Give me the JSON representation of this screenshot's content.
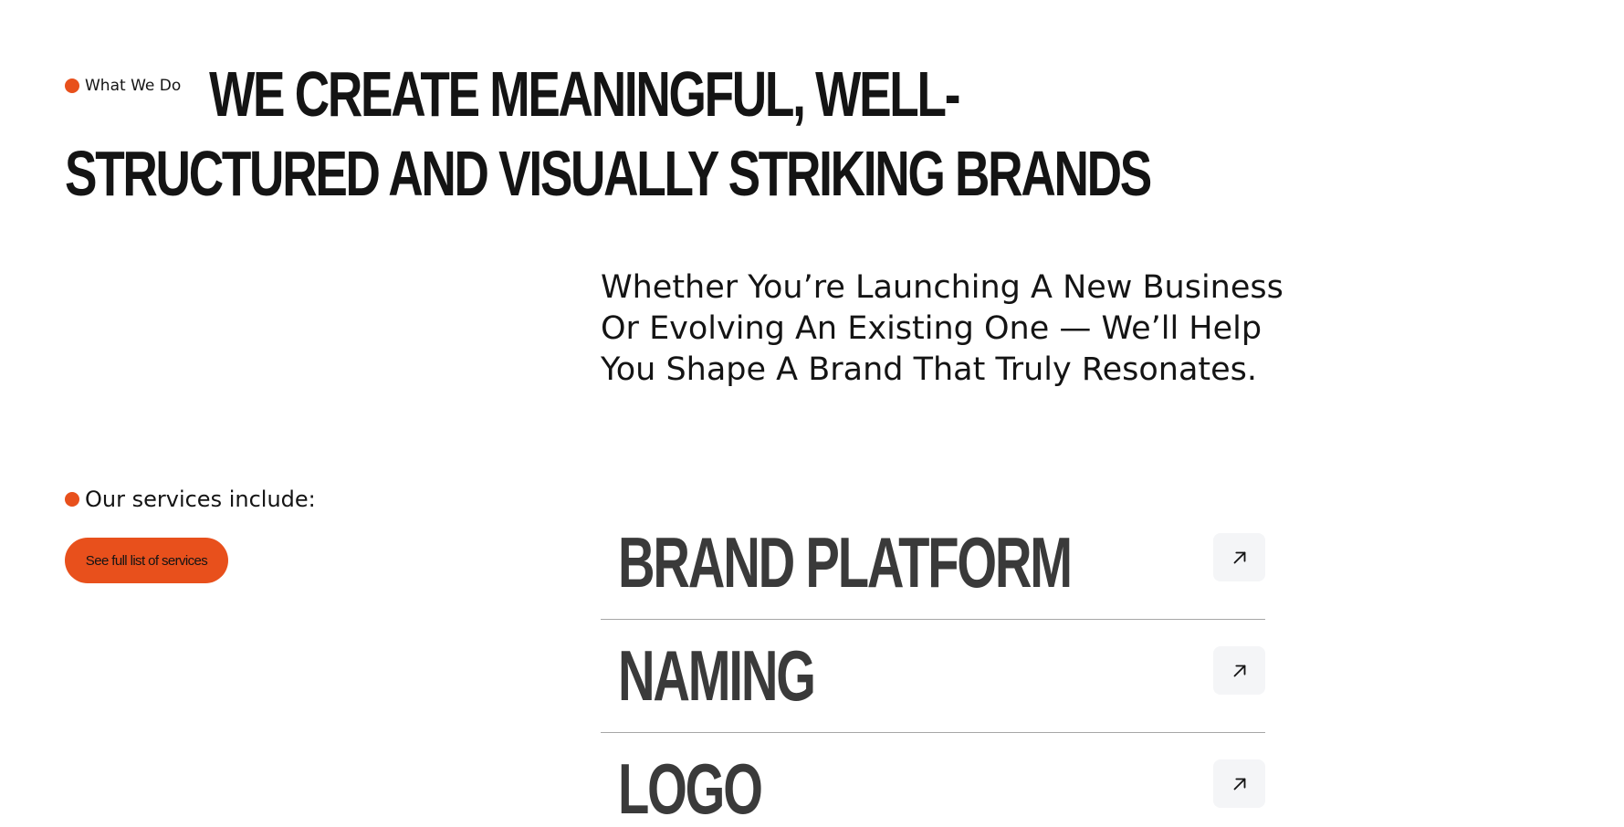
{
  "section": {
    "eyebrow": "What We Do",
    "headline_line1": "WE CREATE MEANINGFUL, WELL-",
    "headline_line2": "STRUCTURED AND VISUALLY STRIKING BRANDS",
    "intro": "Whether You’re Launching A New Business Or Evolving An Existing One — We’ll Help You Shape A Brand That Truly Resonates."
  },
  "services": {
    "label": "Our services include:",
    "button_label": "See full list of services",
    "items": [
      {
        "title": "BRAND PLATFORM",
        "icon": "arrow-up-right-icon"
      },
      {
        "title": "NAMING",
        "icon": "arrow-up-right-icon"
      },
      {
        "title": "LOGO",
        "icon": "arrow-up-right-icon"
      }
    ]
  },
  "colors": {
    "accent": "#e8501c",
    "text": "#141414",
    "service_title": "#3a3a3a",
    "icon_button_bg": "#f4f5f7",
    "divider": "#a6a6a6"
  }
}
